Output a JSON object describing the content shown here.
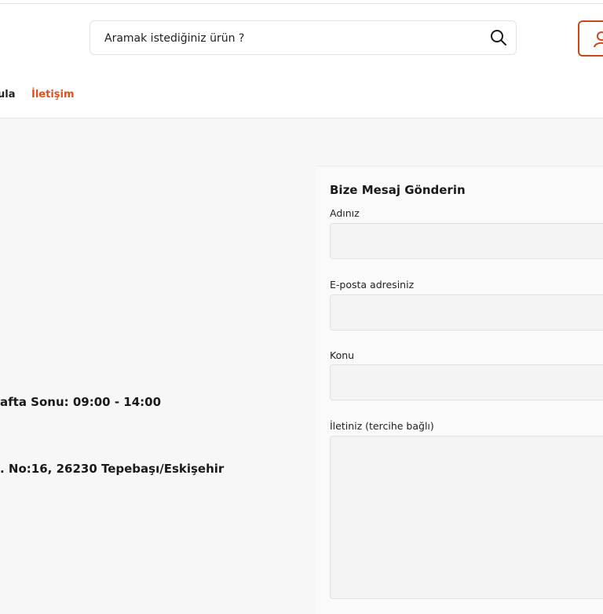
{
  "search": {
    "placeholder": "Aramak istediğiniz ürün ?",
    "icon": "search-icon"
  },
  "account": {
    "icon": "user-icon",
    "accent": "#c8471b"
  },
  "nav": {
    "items": [
      {
        "label": "ula",
        "active": false
      },
      {
        "label": "İletişim",
        "active": true
      }
    ],
    "active_color": "#e0501e"
  },
  "info": {
    "hours": "afta Sonu: 09:00 - 14:00",
    "address": ". No:16, 26230 Tepebaşı/Eskişehir"
  },
  "form": {
    "title": "Bize Mesaj Gönderin",
    "fields": [
      {
        "label": "Adınız",
        "value": ""
      },
      {
        "label": "E-posta adresiniz",
        "value": ""
      },
      {
        "label": "Konu",
        "value": ""
      },
      {
        "label": "İletiniz (tercihe bağlı)",
        "value": ""
      }
    ]
  }
}
